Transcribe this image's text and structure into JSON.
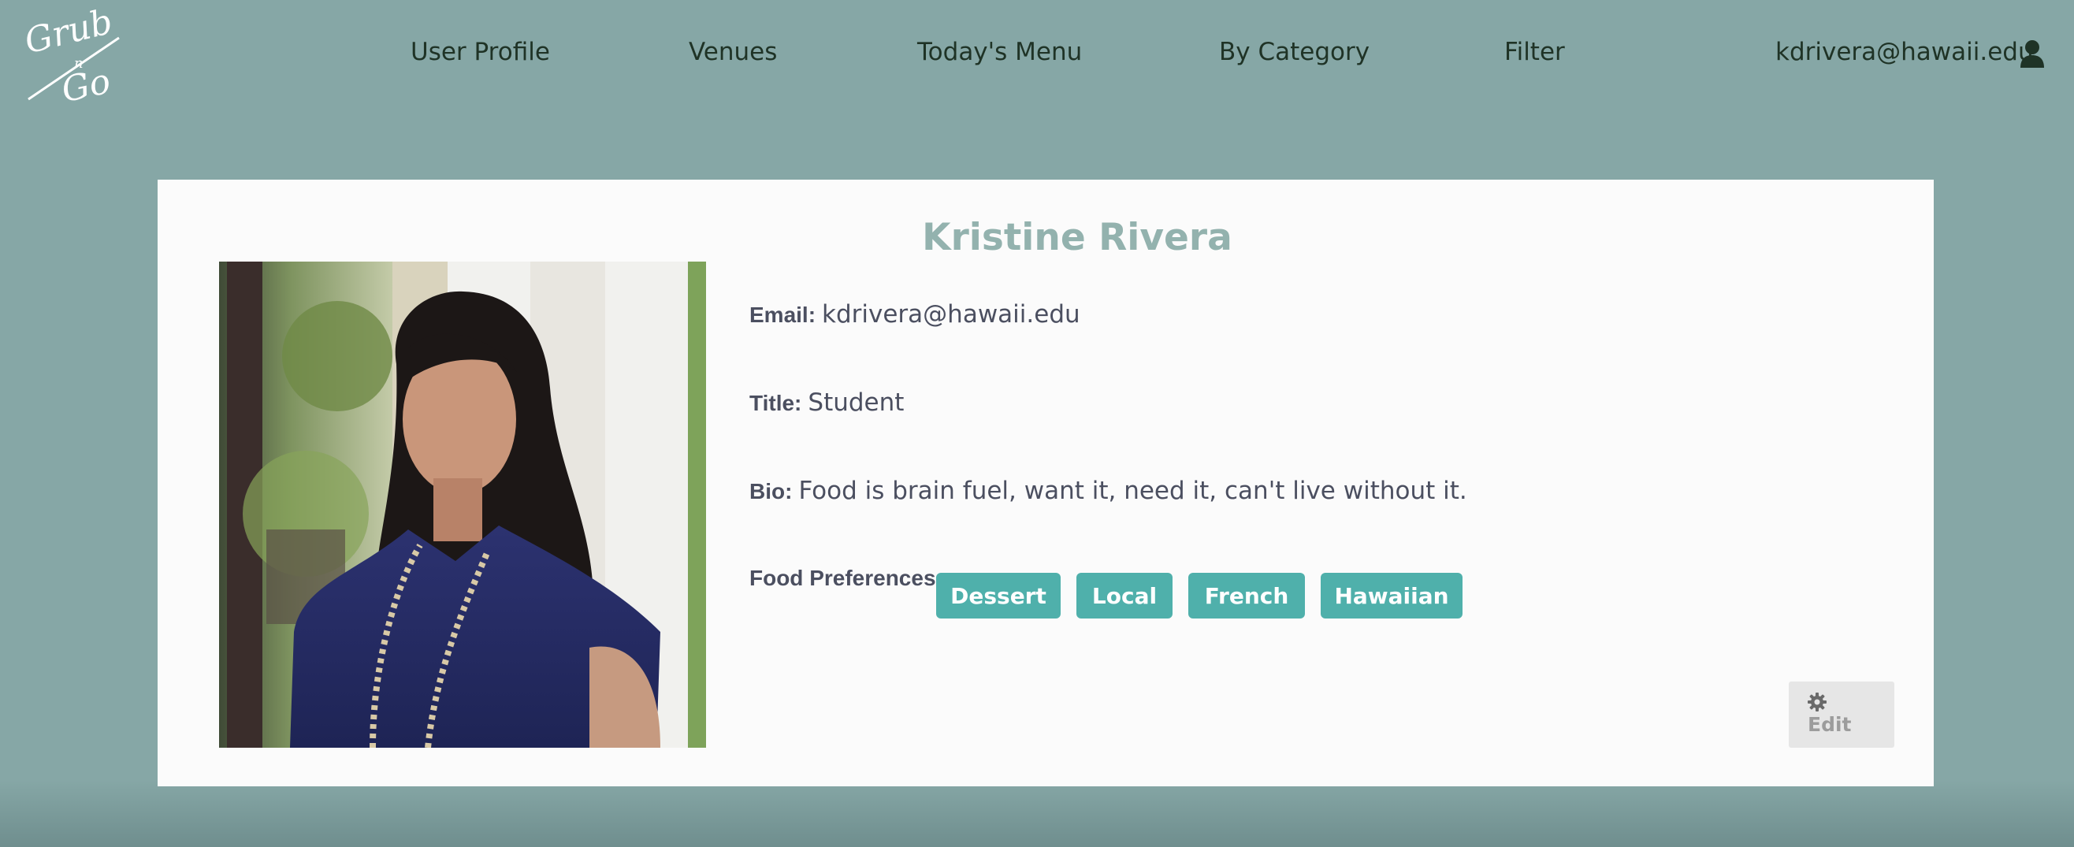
{
  "logo": {
    "text_line1": "Grub",
    "text_mid": "n",
    "text_line2": "Go"
  },
  "nav": {
    "items": [
      {
        "label": "User Profile"
      },
      {
        "label": "Venues"
      },
      {
        "label": "Today's Menu"
      },
      {
        "label": "By Category"
      },
      {
        "label": "Filter"
      }
    ],
    "user_email": "kdrivera@hawaii.edu",
    "user_icon": "user-icon"
  },
  "profile": {
    "name": "Kristine Rivera",
    "photo_alt": "profile-photo",
    "email_label": "Email:",
    "email": "kdrivera@hawaii.edu",
    "title_label": "Title:",
    "title": "Student",
    "bio_label": "Bio:",
    "bio": "Food is brain fuel, want it, need it, can't live without it.",
    "prefs_label": "Food Preferences:",
    "preferences": [
      "Dessert",
      "Local",
      "French",
      "Hawaiian"
    ],
    "edit_label": "Edit",
    "edit_icon": "gear-icon"
  },
  "colors": {
    "background": "#86a7a6",
    "nav_text": "#1f3326",
    "card": "#fbfbfb",
    "name": "#93b2ae",
    "tag": "#4fb0ab",
    "edit_button": "#e6e6e6"
  }
}
